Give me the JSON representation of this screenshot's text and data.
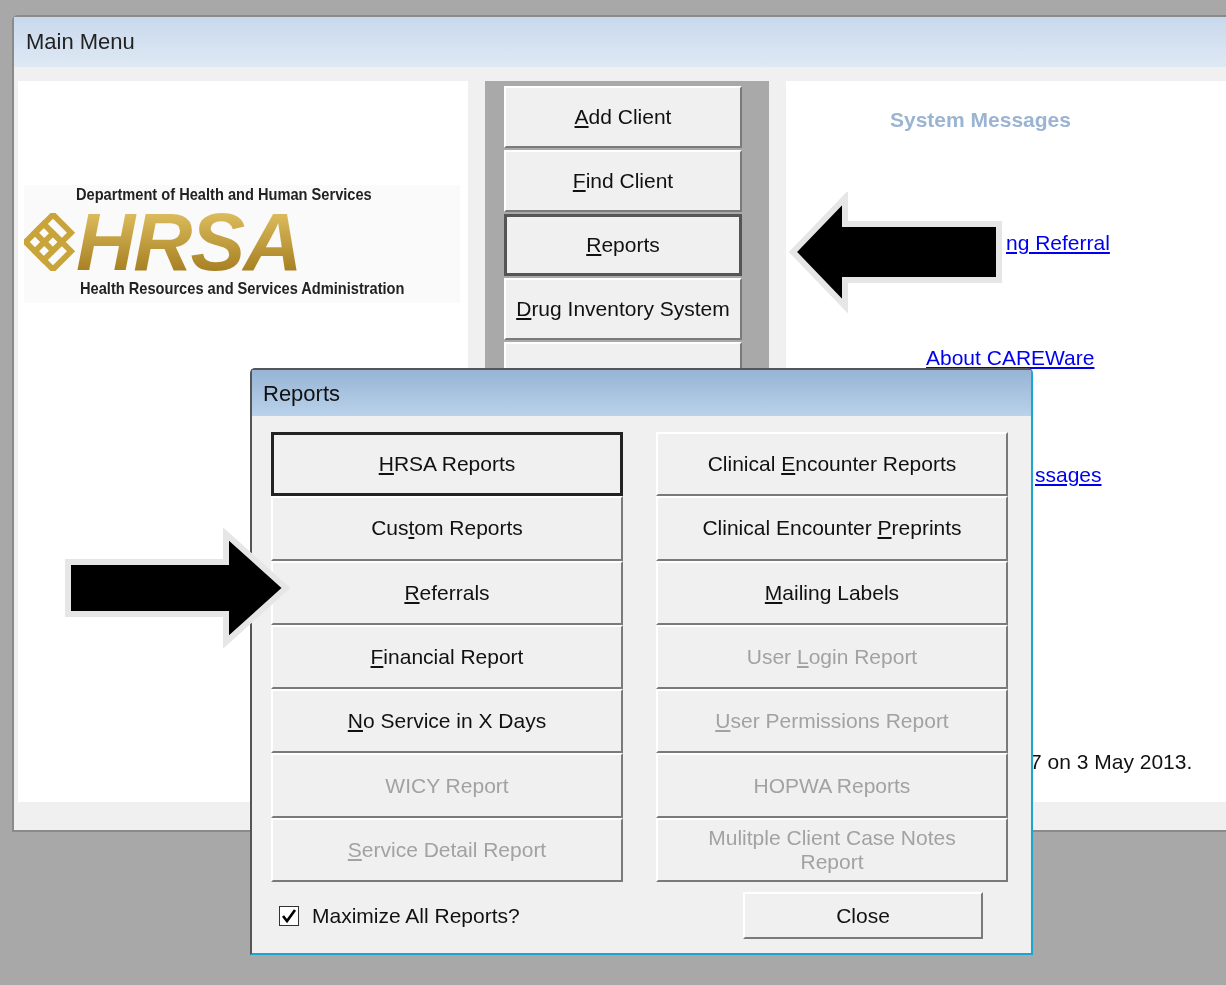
{
  "main_window": {
    "title": "Main Menu",
    "logo": {
      "top_line": "Department of Health and Human Services",
      "wordmark": "HRSA",
      "bottom_line": "Health Resources and Services Administration"
    },
    "menu_buttons": [
      {
        "key": "A",
        "post": "dd Client",
        "focused": false
      },
      {
        "key": "F",
        "post": "ind Client",
        "focused": false
      },
      {
        "key": "R",
        "post": "eports",
        "focused": true
      },
      {
        "key": "D",
        "post": "rug Inventory System",
        "focused": false
      }
    ],
    "system_messages": {
      "heading": "System Messages",
      "items": [
        {
          "kind": "link",
          "text": "ng Referral"
        },
        {
          "kind": "link",
          "text": "About CAREWare"
        },
        {
          "kind": "link",
          "text": "ssages"
        },
        {
          "kind": "text",
          "text": "7 on 3 May 2013."
        }
      ]
    }
  },
  "dialog": {
    "title": "Reports",
    "left_buttons": [
      {
        "key": "H",
        "post": "RSA Reports",
        "disabled": false,
        "focused": true
      },
      {
        "pre": "Cus",
        "key": "t",
        "post": "om Reports",
        "disabled": false,
        "focused": false
      },
      {
        "key": "R",
        "post": "eferrals",
        "disabled": false,
        "focused": false
      },
      {
        "key": "F",
        "post": "inancial Report",
        "disabled": false,
        "focused": false
      },
      {
        "key": "N",
        "post": "o Service in X Days",
        "disabled": false,
        "focused": false
      },
      {
        "pre": "WICY Report",
        "disabled": true,
        "focused": false
      },
      {
        "key": "S",
        "post": "ervice Detail Report",
        "disabled": true,
        "focused": false
      }
    ],
    "right_buttons": [
      {
        "pre": "Clinical ",
        "key": "E",
        "post": "ncounter Reports",
        "disabled": false,
        "focused": false
      },
      {
        "pre": "Clinical Encounter ",
        "key": "P",
        "post": "reprints",
        "disabled": false,
        "focused": false
      },
      {
        "key": "M",
        "post": "ailing Labels",
        "disabled": false,
        "focused": false
      },
      {
        "pre": "User ",
        "key": "L",
        "post": "ogin Report",
        "disabled": true,
        "focused": false
      },
      {
        "key": "U",
        "post": "ser Permissions Report",
        "disabled": true,
        "focused": false
      },
      {
        "pre": "HOPWA Reports",
        "disabled": true,
        "focused": false
      },
      {
        "pre": "Mulitple Client Case Notes Report",
        "disabled": true,
        "focused": false
      }
    ],
    "maximize": {
      "label": "Maximize All Reports?",
      "checked": true
    },
    "close_button": "Close"
  }
}
